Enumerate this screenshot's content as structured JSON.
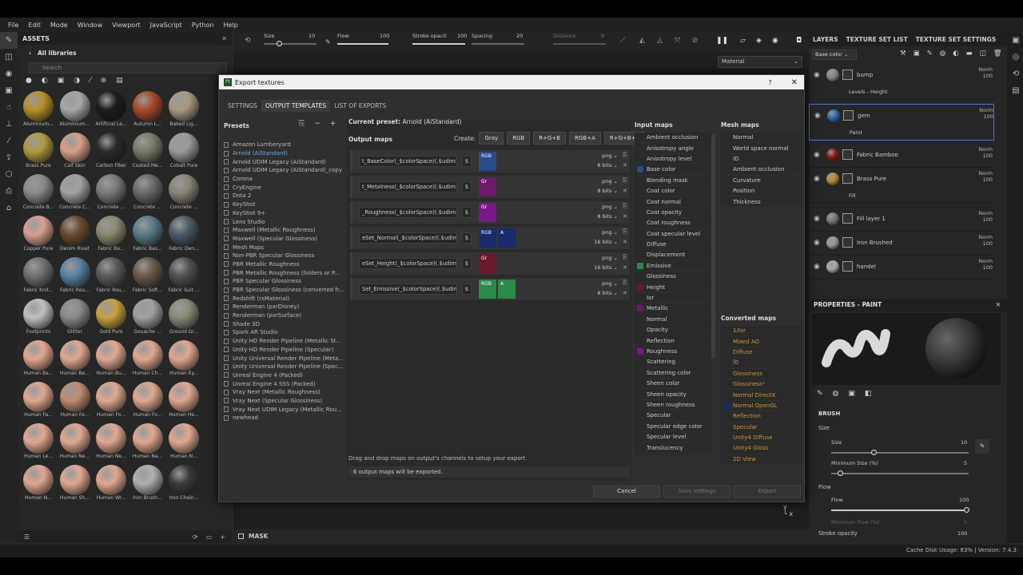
{
  "menu": [
    "File",
    "Edit",
    "Mode",
    "Window",
    "Viewport",
    "JavaScript",
    "Python",
    "Help"
  ],
  "assets": {
    "title": "ASSETS",
    "library": "All libraries",
    "search_placeholder": "Search",
    "materials": [
      {
        "name": "Aluminium...",
        "color": "#b8902a"
      },
      {
        "name": "Aluminium...",
        "color": "#a8a8a8"
      },
      {
        "name": "Artificial Le...",
        "color": "#1c1c1c"
      },
      {
        "name": "Autumn L...",
        "color": "#a84a2a"
      },
      {
        "name": "Baked Lig...",
        "color": "#a89a80"
      },
      {
        "name": "Brass Pure",
        "color": "#b09a40"
      },
      {
        "name": "Calf Skin",
        "color": "#d6a08a"
      },
      {
        "name": "Carbon Fiber",
        "color": "#2a2a2a"
      },
      {
        "name": "Coated Me...",
        "color": "#7a7a6a"
      },
      {
        "name": "Cobalt Pure",
        "color": "#9a9a9a"
      },
      {
        "name": "Concrete B...",
        "color": "#8a8a8a"
      },
      {
        "name": "Concrete C...",
        "color": "#a0a0a0"
      },
      {
        "name": "Concrete ...",
        "color": "#7a7a7a"
      },
      {
        "name": "Concrete ...",
        "color": "#6a6a6a"
      },
      {
        "name": "Concrete ...",
        "color": "#8a8478"
      },
      {
        "name": "Copper Pure",
        "color": "#d8a090"
      },
      {
        "name": "Denim Rivet",
        "color": "#6a4a30"
      },
      {
        "name": "Fabric Ba...",
        "color": "#8a8a70"
      },
      {
        "name": "Fabric Bas...",
        "color": "#5a7a8a"
      },
      {
        "name": "Fabric Den...",
        "color": "#4a5a6a"
      },
      {
        "name": "Fabric Knit...",
        "color": "#707070"
      },
      {
        "name": "Fabric Rou...",
        "color": "#5a80a0"
      },
      {
        "name": "Fabric Rou...",
        "color": "#5a5a5a"
      },
      {
        "name": "Fabric Soft...",
        "color": "#6a5a4a"
      },
      {
        "name": "Fabric Suit ...",
        "color": "#505050"
      },
      {
        "name": "Footprints",
        "color": "#c0c0c0"
      },
      {
        "name": "Glitter",
        "color": "#8a8a8a"
      },
      {
        "name": "Gold Pure",
        "color": "#c8a040"
      },
      {
        "name": "Gouache ...",
        "color": "#a0a0a0"
      },
      {
        "name": "Ground Gr...",
        "color": "#8a8a78"
      },
      {
        "name": "Human Ba...",
        "color": "#e0a890"
      },
      {
        "name": "Human Be...",
        "color": "#e0a890"
      },
      {
        "name": "Human Bu...",
        "color": "#e0a890"
      },
      {
        "name": "Human Ch...",
        "color": "#e0a890"
      },
      {
        "name": "Human Ey...",
        "color": "#e0a890"
      },
      {
        "name": "Human Fa...",
        "color": "#e0a890"
      },
      {
        "name": "Human Fe...",
        "color": "#c08a70"
      },
      {
        "name": "Human Fo...",
        "color": "#e0a890"
      },
      {
        "name": "Human Fo...",
        "color": "#e0a890"
      },
      {
        "name": "Human He...",
        "color": "#e0a890"
      },
      {
        "name": "Human Le...",
        "color": "#e0a890"
      },
      {
        "name": "Human Ne...",
        "color": "#e0a890"
      },
      {
        "name": "Human Ne...",
        "color": "#e0a890"
      },
      {
        "name": "Human Na...",
        "color": "#e0a890"
      },
      {
        "name": "Human N...",
        "color": "#e0a890"
      },
      {
        "name": "Human N...",
        "color": "#e0a890"
      },
      {
        "name": "Human Sh...",
        "color": "#e0a890"
      },
      {
        "name": "Human Wr...",
        "color": "#e0a890"
      },
      {
        "name": "Iron Brush...",
        "color": "#b0b0b0"
      },
      {
        "name": "Iron Chain...",
        "color": "#3a3a3a"
      }
    ]
  },
  "toolbar": {
    "size_label": "Size",
    "size_value": "10",
    "flow_label": "Flow",
    "flow_value": "100",
    "stroke_label": "Stroke opacit",
    "stroke_value": "100",
    "spacing_label": "Spacing",
    "spacing_value": "20",
    "distance_label": "Distance",
    "distance_value": "8"
  },
  "viewport": {
    "mode_select": "Material",
    "mask_label": "MASK"
  },
  "dialog": {
    "title": "Export textures",
    "tabs": [
      "SETTINGS",
      "OUTPUT TEMPLATES",
      "LIST OF EXPORTS"
    ],
    "presets_label": "Presets",
    "presets": [
      "Amazon Lumberyard",
      "Arnold (AiStandard)",
      "Arnold UDIM Legacy (AiStandard)",
      "Arnold UDIM Legacy (AiStandard)_copy",
      "Corona",
      "CryEngine",
      "Dota 2",
      "KeyShot",
      "KeyShot 9+",
      "Lens Studio",
      "Maxwell (Metallic Roughness)",
      "Maxwell (Specular Glossiness)",
      "Mesh Maps",
      "Non-PBR Specular Glossiness",
      "PBR Metallic Roughness",
      "PBR Metallic Roughness (folders or P...",
      "PBR Specular Glossiness",
      "PBR Specular Glossiness (converted fr...",
      "Redshift (rsMaterial)",
      "Renderman (pxrDisney)",
      "Renderman (pxrSurface)",
      "Shade 3D",
      "Spark AR Studio",
      "Unity HD Render Pipeline (Metallic St...",
      "Unity HD Render Pipeline (Specular)",
      "Unity Universal Render Pipeline (Meta...",
      "Unity Universal Render Pipeline (Spec...",
      "Unreal Engine 4 (Packed)",
      "Unreal Engine 4 SSS (Packed)",
      "Vray Next (Metallic Roughness)",
      "Vray Next (Specular Glossiness)",
      "Vray Next UDIM Legacy (Metallic Rou...",
      "newhead"
    ],
    "current_preset_label": "Current preset:",
    "current_preset": "Arnold (AiStandard)",
    "output_maps_label": "Output maps",
    "create_label": "Create:",
    "create_buttons": [
      "Gray",
      "RGB",
      "R+G+B",
      "RGB+A",
      "R+G+B+A"
    ],
    "outputs": [
      {
        "name": "t_BaseColor(_$colorSpace)(.$udim)",
        "ch1": "RGB",
        "ch1color": "#2a4a8a",
        "ch2": "",
        "fmt": "png",
        "bits": "8 bits"
      },
      {
        "name": "t_Metalness(_$colorSpace)(.$udim)",
        "ch1": "Gr",
        "ch1color": "#6a1a6a",
        "ch2": "",
        "fmt": "png",
        "bits": "8 bits"
      },
      {
        "name": "_Roughness(_$colorSpace)(.$udim)",
        "ch1": "Gr",
        "ch1color": "#7a1a8a",
        "ch2": "",
        "fmt": "png",
        "bits": "8 bits"
      },
      {
        "name": "eSet_Normal(_$colorSpace)(.$udim)",
        "ch1": "RGB",
        "ch1color": "#1a2a6a",
        "ch2": "A",
        "fmt": "png",
        "bits": "16 bits"
      },
      {
        "name": "eSet_Height(_$colorSpace)(.$udim)",
        "ch1": "Gr",
        "ch1color": "#6a1a2a",
        "ch2": "",
        "fmt": "png",
        "bits": "16 bits"
      },
      {
        "name": "Set_Emissive(_$colorSpace)(.$udim)",
        "ch1": "RGB",
        "ch1color": "#2a8a4a",
        "ch2": "A",
        "fmt": "png",
        "bits": "8 bits"
      }
    ],
    "hint": "Drag and drop maps on output's channels to setup your export.",
    "count_text": "6 output maps will be exported.",
    "input_maps_label": "Input maps",
    "input_maps": [
      "Ambient occlusion",
      "Anisotropy angle",
      "Anisotropy level",
      "Base color",
      "Blending mask",
      "Coat color",
      "Coat normal",
      "Coat opacity",
      "Coat roughness",
      "Coat specular level",
      "Diffuse",
      "Displacement",
      "Emissive",
      "Glossiness",
      "Height",
      "Ior",
      "Metallic",
      "Normal",
      "Opacity",
      "Reflection",
      "Roughness",
      "Scattering",
      "Scattering color",
      "Sheen color",
      "Sheen opacity",
      "Sheen roughness",
      "Specular",
      "Specular edge color",
      "Specular level",
      "Translucency",
      "Transmissive"
    ],
    "mesh_maps_label": "Mesh maps",
    "mesh_maps": [
      "Normal",
      "World space normal",
      "ID",
      "Ambient occlusion",
      "Curvature",
      "Position",
      "Thickness"
    ],
    "converted_maps_label": "Converted maps",
    "converted_maps": [
      "1/Ior",
      "Mixed AO",
      "Diffuse",
      "f0",
      "Glossiness",
      "Glossiness²",
      "Normal DirectX",
      "Normal OpenGL",
      "Reflection",
      "Specular",
      "Unity4 Diffuse",
      "Unity4 Gloss",
      "2D View"
    ],
    "cancel": "Cancel",
    "save": "Save settings",
    "export": "Export"
  },
  "layers": {
    "tabs": [
      "LAYERS",
      "TEXTURE SET LIST",
      "TEXTURE SET SETTINGS"
    ],
    "channel": "Base color",
    "items": [
      {
        "name": "bump",
        "mode": "Norm",
        "op": "100",
        "color": "#888",
        "sub": "Levels - Height"
      },
      {
        "name": "gem",
        "mode": "Norm",
        "op": "100",
        "color": "#2a6ab0",
        "sub": "Paint"
      },
      {
        "name": "Fabric Bamboo",
        "mode": "Norm",
        "op": "100",
        "color": "#8a1a1a",
        "sub": ""
      },
      {
        "name": "Brass Pure",
        "mode": "Norm",
        "op": "100",
        "color": "#b88a30",
        "sub": "Fill"
      },
      {
        "name": "Fill layer 1",
        "mode": "Norm",
        "op": "100",
        "color": "#777",
        "sub": ""
      },
      {
        "name": "Iron Brushed",
        "mode": "Norm",
        "op": "100",
        "color": "#999",
        "sub": ""
      },
      {
        "name": "handel",
        "mode": "Norm",
        "op": "100",
        "color": "#aaa",
        "sub": ""
      }
    ]
  },
  "properties": {
    "title": "PROPERTIES - PAINT",
    "brush": "BRUSH",
    "size": "Size",
    "size_val": "10",
    "min_size": "Minimum Size (%)",
    "min_size_val": "5",
    "flow": "Flow",
    "flow_val": "100",
    "min_flow": "Minimum Flow (%)",
    "min_flow_val": "5",
    "stroke": "Stroke opacity",
    "stroke_val": "100"
  },
  "status": "Cache Disk Usage:   83% | Version: 7.4.3"
}
